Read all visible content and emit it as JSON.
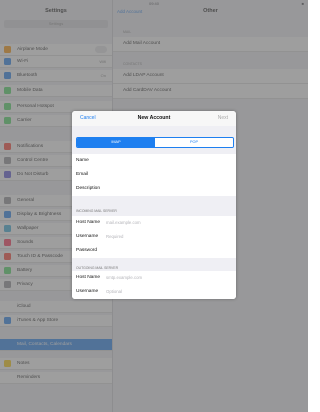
{
  "status": {
    "time": "09:40",
    "battery": "■"
  },
  "left": {
    "title": "Settings",
    "search": "Settings",
    "items": [
      {
        "label": "Airplane Mode",
        "color": "#ff9500",
        "toggle": true
      },
      {
        "label": "Wi-Fi",
        "color": "#1e7ff0",
        "value": "Wifi"
      },
      {
        "label": "Bluetooth",
        "color": "#1e7ff0",
        "value": "On"
      },
      {
        "label": "Mobile Data",
        "color": "#4cd964"
      },
      {
        "label": "Personal Hotspot",
        "color": "#4cd964"
      },
      {
        "label": "Carrier",
        "color": "#4cd964"
      },
      {
        "label": "Notifications",
        "color": "#ff3b30"
      },
      {
        "label": "Control Centre",
        "color": "#8e8e93"
      },
      {
        "label": "Do Not Disturb",
        "color": "#5856d6"
      },
      {
        "label": "General",
        "color": "#8e8e93"
      },
      {
        "label": "Display & Brightness",
        "color": "#1e7ff0"
      },
      {
        "label": "Wallpaper",
        "color": "#34aadc"
      },
      {
        "label": "Sounds",
        "color": "#ff2d55"
      },
      {
        "label": "Touch ID & Passcode",
        "color": "#ff3b30"
      },
      {
        "label": "Battery",
        "color": "#4cd964"
      },
      {
        "label": "Privacy",
        "color": "#8e8e93"
      },
      {
        "label": "iCloud",
        "color": "#ffffff"
      },
      {
        "label": "iTunes & App Store",
        "color": "#1e7ff0"
      },
      {
        "label": "Mail, Contacts, Calendars",
        "color": "#1e7ff0",
        "selected": true
      },
      {
        "label": "Notes",
        "color": "#ffcc00"
      },
      {
        "label": "Reminders",
        "color": "#ffffff"
      }
    ]
  },
  "right": {
    "back": "Add Account",
    "title": "Other",
    "sec1": "MAIL",
    "row1": "Add Mail Account",
    "sec2": "CONTACTS",
    "row2": "Add LDAP Account",
    "row3": "Add CardDAV Account"
  },
  "modal": {
    "cancel": "Cancel",
    "title": "New Account",
    "next": "Next",
    "seg_imap": "IMAP",
    "seg_pop": "POP",
    "name": "Name",
    "email": "Email",
    "description": "Description",
    "incoming_header": "INCOMING MAIL SERVER",
    "host_name": "Host Name",
    "host_placeholder": "mail.example.com",
    "username": "Username",
    "username_placeholder_in": "Required",
    "password": "Password",
    "outgoing_header": "OUTGOING MAIL SERVER",
    "host_name_out": "Host Name",
    "host_placeholder_out": "smtp.example.com",
    "username_out": "Username",
    "username_placeholder_out": "Optional"
  }
}
